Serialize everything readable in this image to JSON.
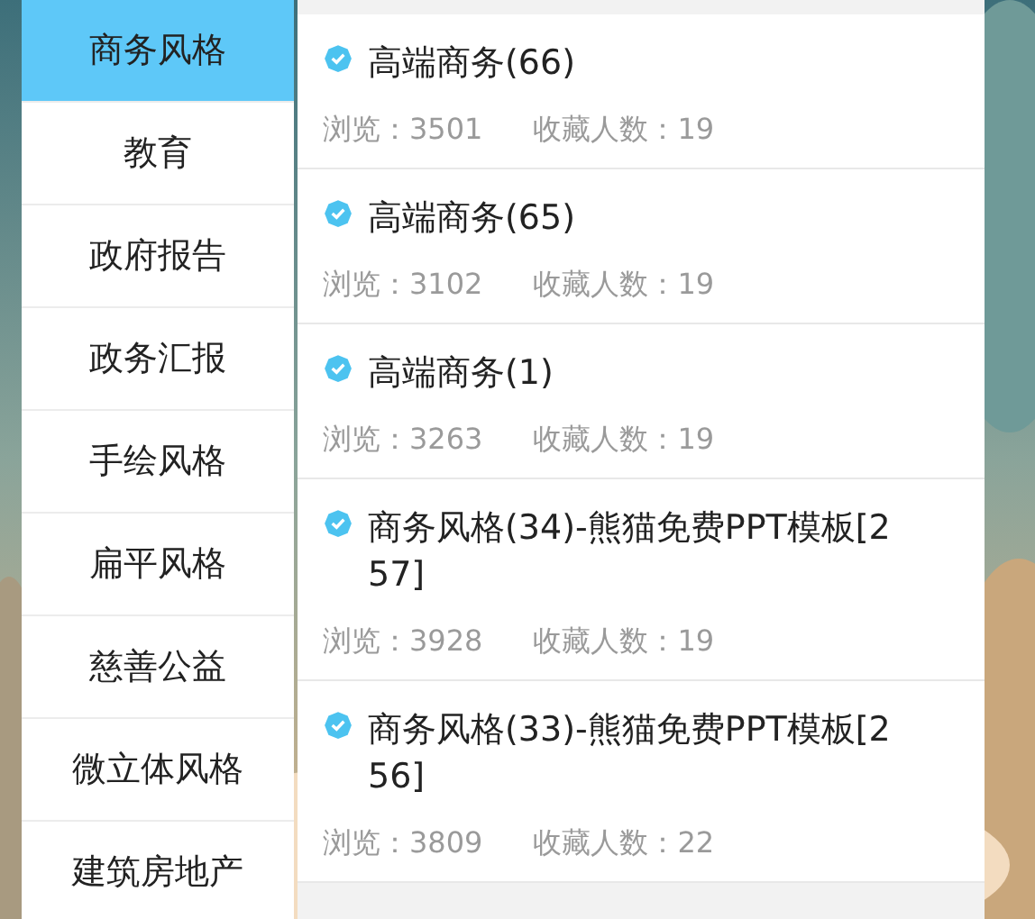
{
  "sidebar": {
    "items": [
      {
        "label": "商务风格",
        "selected": true
      },
      {
        "label": "教育",
        "selected": false
      },
      {
        "label": "政府报告",
        "selected": false
      },
      {
        "label": "政务汇报",
        "selected": false
      },
      {
        "label": "手绘风格",
        "selected": false
      },
      {
        "label": "扁平风格",
        "selected": false
      },
      {
        "label": "慈善公益",
        "selected": false
      },
      {
        "label": "微立体风格",
        "selected": false
      },
      {
        "label": "建筑房地产",
        "selected": false
      }
    ]
  },
  "list": {
    "items": [
      {
        "title": "高端商务(66)",
        "views": "浏览：3501",
        "favorites": "收藏人数：19"
      },
      {
        "title": "高端商务(65)",
        "views": "浏览：3102",
        "favorites": "收藏人数：19"
      },
      {
        "title": "高端商务(1)",
        "views": "浏览：3263",
        "favorites": "收藏人数：19"
      },
      {
        "title": "商务风格(34)-熊猫免费PPT模板[257]",
        "views": "浏览：3928",
        "favorites": "收藏人数：19"
      },
      {
        "title": "商务风格(33)-熊猫免费PPT模板[256]",
        "views": "浏览：3809",
        "favorites": "收藏人数：22"
      }
    ]
  }
}
